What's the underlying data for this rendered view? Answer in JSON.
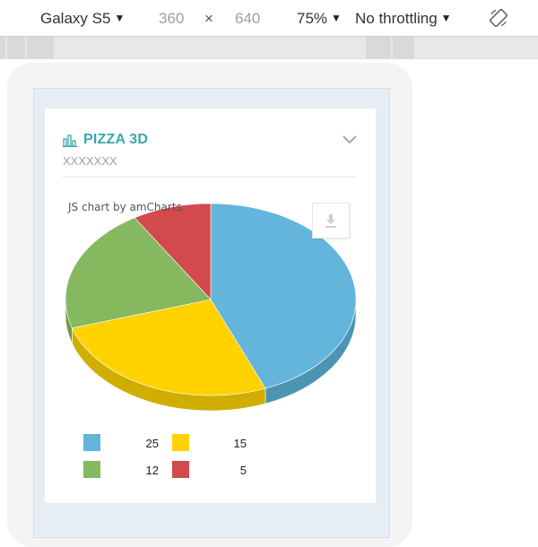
{
  "toolbar": {
    "device": "Galaxy S5",
    "width": "360",
    "times": "×",
    "height": "640",
    "zoom": "75%",
    "throttle": "No throttling"
  },
  "card": {
    "title": "PIZZA 3D",
    "subtitle": "XXXXXXX"
  },
  "chart_credit": "JS chart by amCharts",
  "chart_data": {
    "type": "pie",
    "three_d": true,
    "values": [
      25,
      15,
      12,
      5
    ],
    "colors": [
      "#63b5dc",
      "#ffd200",
      "#86b860",
      "#d24a4b"
    ],
    "side_colors": [
      "#4d94b4",
      "#cfae00",
      "#6a9a48",
      "#a83a3b"
    ],
    "legend_values": [
      "25",
      "15",
      "12",
      "5"
    ],
    "legend_placement": "bottom"
  },
  "icons": {
    "bar_chart": "bar-chart-icon",
    "chevron": "chevron-down-icon",
    "export": "download-icon",
    "rotate": "rotate-icon"
  }
}
